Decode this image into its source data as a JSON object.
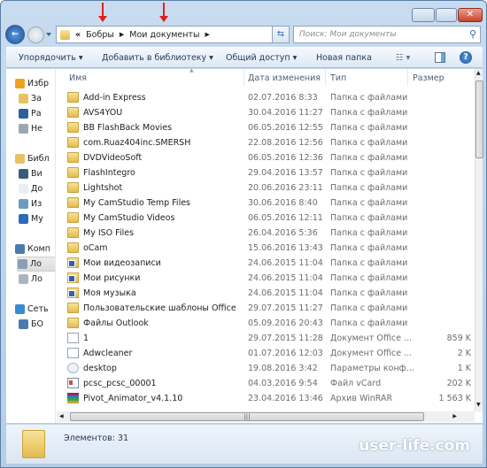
{
  "window": {
    "controls": [
      "minimize",
      "maximize",
      "close"
    ]
  },
  "address": {
    "crumbs": [
      "Бобры",
      "Мои документы"
    ],
    "prefix": "«"
  },
  "search": {
    "placeholder": "Поиск: Мои документы"
  },
  "toolbar": {
    "organize": "Упорядочить",
    "add_library": "Добавить в библиотеку",
    "share": "Общий доступ",
    "new_folder": "Новая папка"
  },
  "sidebar": {
    "items": [
      {
        "label": "Избр",
        "icon": "star-icon"
      },
      {
        "label": "За",
        "icon": "downloads-icon"
      },
      {
        "label": "Ра",
        "icon": "desktop-icon"
      },
      {
        "label": "Не",
        "icon": "recent-places-icon"
      },
      {
        "label": "Библ",
        "icon": "libraries-icon"
      },
      {
        "label": "Ви",
        "icon": "video-icon"
      },
      {
        "label": "До",
        "icon": "documents-icon"
      },
      {
        "label": "Из",
        "icon": "pictures-icon"
      },
      {
        "label": "Му",
        "icon": "music-icon"
      },
      {
        "label": "Комп",
        "icon": "computer-icon"
      },
      {
        "label": "Ло",
        "icon": "local-disk-icon",
        "selected": true
      },
      {
        "label": "Ло",
        "icon": "drive-icon"
      },
      {
        "label": "Сеть",
        "icon": "network-icon"
      },
      {
        "label": "БО",
        "icon": "network-computer-icon"
      }
    ]
  },
  "columns": {
    "name": "Имя",
    "date": "Дата изменения",
    "type": "Тип",
    "size": "Размер"
  },
  "files": [
    {
      "name": "Add-in Express",
      "date": "02.07.2016 8:33",
      "type": "Папка с файлами",
      "size": "",
      "icon": "folder"
    },
    {
      "name": "AVS4YOU",
      "date": "30.04.2016 11:27",
      "type": "Папка с файлами",
      "size": "",
      "icon": "folder"
    },
    {
      "name": "BB FlashBack Movies",
      "date": "06.05.2016 12:55",
      "type": "Папка с файлами",
      "size": "",
      "icon": "folder"
    },
    {
      "name": "com.Ruaz404inc.SMERSH",
      "date": "22.08.2016 12:56",
      "type": "Папка с файлами",
      "size": "",
      "icon": "folder"
    },
    {
      "name": "DVDVideoSoft",
      "date": "06.05.2016 12:36",
      "type": "Папка с файлами",
      "size": "",
      "icon": "folder"
    },
    {
      "name": "FlashIntegro",
      "date": "29.04.2016 13:57",
      "type": "Папка с файлами",
      "size": "",
      "icon": "folder"
    },
    {
      "name": "Lightshot",
      "date": "20.06.2016 23:11",
      "type": "Папка с файлами",
      "size": "",
      "icon": "folder"
    },
    {
      "name": "My CamStudio Temp Files",
      "date": "30.06.2016 8:40",
      "type": "Папка с файлами",
      "size": "",
      "icon": "folder"
    },
    {
      "name": "My CamStudio Videos",
      "date": "06.05.2016 12:11",
      "type": "Папка с файлами",
      "size": "",
      "icon": "folder"
    },
    {
      "name": "My ISO Files",
      "date": "26.04.2016 5:36",
      "type": "Папка с файлами",
      "size": "",
      "icon": "folder"
    },
    {
      "name": "oCam",
      "date": "15.06.2016 13:43",
      "type": "Папка с файлами",
      "size": "",
      "icon": "folder"
    },
    {
      "name": "Мои видеозаписи",
      "date": "24.06.2015 11:04",
      "type": "Папка с файлами",
      "size": "",
      "icon": "lnk"
    },
    {
      "name": "Мои рисунки",
      "date": "24.06.2015 11:04",
      "type": "Папка с файлами",
      "size": "",
      "icon": "lnk"
    },
    {
      "name": "Моя музыка",
      "date": "24.06.2015 11:04",
      "type": "Папка с файлами",
      "size": "",
      "icon": "lnk"
    },
    {
      "name": "Пользовательские шаблоны Office",
      "date": "29.07.2015 11:27",
      "type": "Папка с файлами",
      "size": "",
      "icon": "folder"
    },
    {
      "name": "Файлы Outlook",
      "date": "05.09.2016 20:43",
      "type": "Папка с файлами",
      "size": "",
      "icon": "folder"
    },
    {
      "name": "1",
      "date": "29.07.2015 11:28",
      "type": "Документ Office ...",
      "size": "859 K",
      "icon": "doc"
    },
    {
      "name": "Adwcleaner",
      "date": "01.07.2016 12:03",
      "type": "Документ Office ...",
      "size": "2 K",
      "icon": "doc"
    },
    {
      "name": "desktop",
      "date": "19.08.2016 3:42",
      "type": "Параметры конф...",
      "size": "1 K",
      "icon": "cfg"
    },
    {
      "name": "pcsc_pcsc_00001",
      "date": "04.03.2016 9:54",
      "type": "Файл vCard",
      "size": "202 K",
      "icon": "vcard"
    },
    {
      "name": "Pivot_Animator_v4.1.10",
      "date": "23.04.2016 13:46",
      "type": "Архив WinRAR",
      "size": "1 563 K",
      "icon": "rar"
    }
  ],
  "status": {
    "count": "Элементов: 31"
  },
  "watermark": "user-life.com",
  "colors": {
    "annotation_arrow": "#e02020",
    "frame": "#b6cde6"
  }
}
